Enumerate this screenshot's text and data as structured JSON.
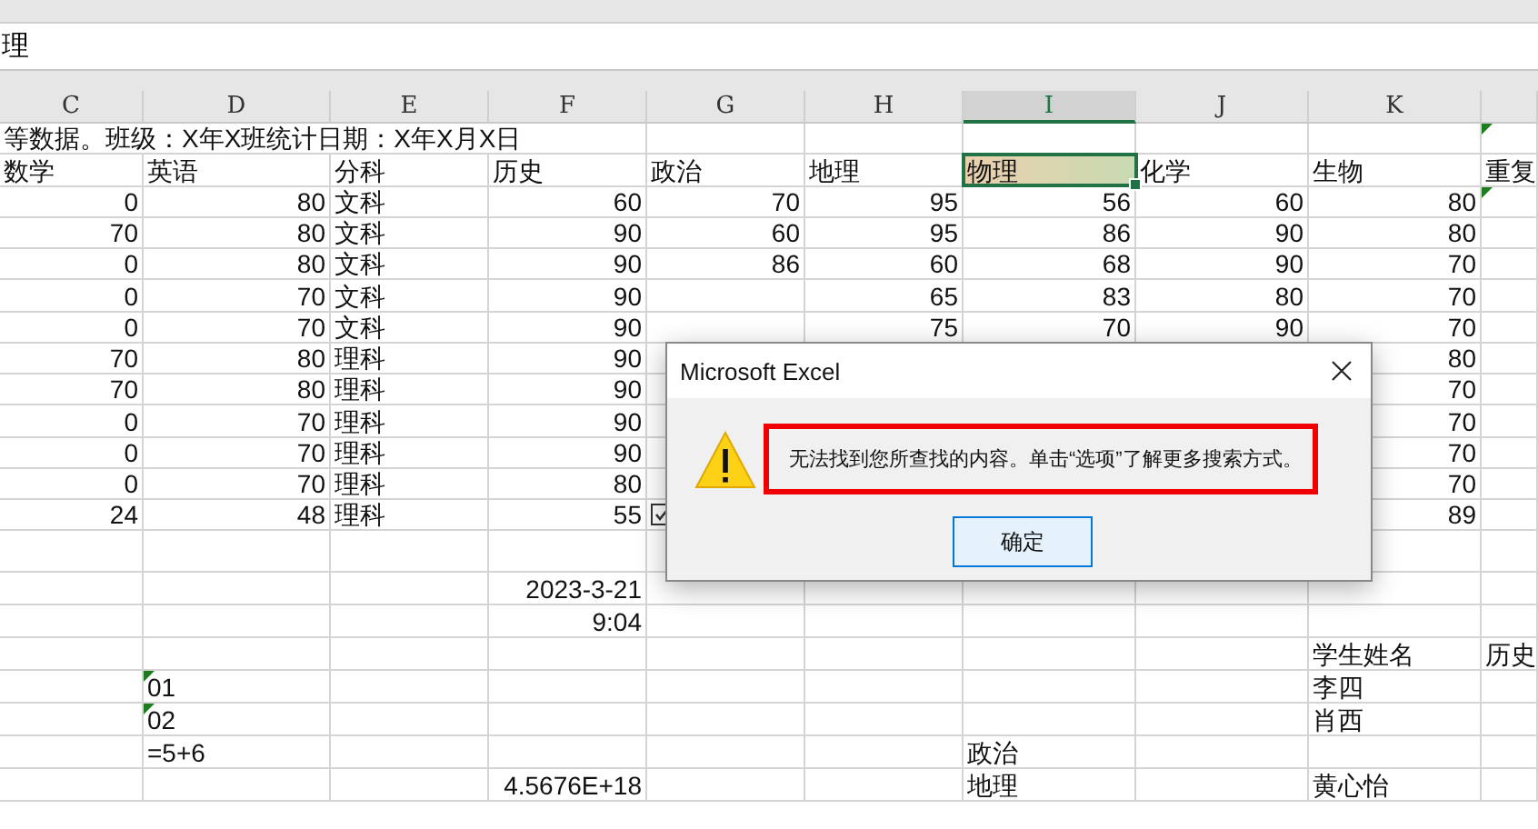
{
  "formula_bar": {
    "value": "理"
  },
  "columns": [
    {
      "label": "C",
      "selected": false
    },
    {
      "label": "D",
      "selected": false
    },
    {
      "label": "E",
      "selected": false
    },
    {
      "label": "F",
      "selected": false
    },
    {
      "label": "G",
      "selected": false
    },
    {
      "label": "H",
      "selected": false
    },
    {
      "label": "I",
      "selected": true
    },
    {
      "label": "J",
      "selected": false
    },
    {
      "label": "K",
      "selected": false
    },
    {
      "selected": false
    }
  ],
  "rows": [
    {
      "cells": [
        {
          "text": "等数据。班级：X年X班统计日期：X年X月X日",
          "kind": "overflow_text"
        },
        null,
        null,
        null,
        null,
        null,
        null,
        null,
        null,
        {
          "kind": "flag_only",
          "error_flag": true
        }
      ]
    },
    {
      "cells": [
        {
          "text": "数学",
          "kind": "text",
          "selected": false
        },
        {
          "text": "英语",
          "kind": "text",
          "selected": false
        },
        {
          "text": "分科",
          "kind": "text",
          "selected": false
        },
        {
          "text": "历史",
          "kind": "text",
          "selected": false
        },
        {
          "text": "政治",
          "kind": "text",
          "selected": false
        },
        {
          "text": "地理",
          "kind": "text",
          "selected": false
        },
        {
          "text": "物理",
          "kind": "text",
          "selected": true
        },
        {
          "text": "化学",
          "kind": "text",
          "selected": false
        },
        {
          "text": "生物",
          "kind": "text",
          "selected": false
        },
        {
          "text": "重复",
          "kind": "text",
          "selected": false
        }
      ]
    },
    {
      "cells": [
        {
          "text": "0",
          "kind": "number"
        },
        {
          "text": "80",
          "kind": "number"
        },
        {
          "text": "文科",
          "kind": "text"
        },
        {
          "text": "60",
          "kind": "number"
        },
        {
          "text": "70",
          "kind": "number"
        },
        {
          "text": "95",
          "kind": "number"
        },
        {
          "text": "56",
          "kind": "number"
        },
        {
          "text": "60",
          "kind": "number"
        },
        {
          "text": "80",
          "kind": "number"
        },
        {
          "kind": "flag_only",
          "error_flag": true
        }
      ]
    },
    {
      "cells": [
        {
          "text": "70",
          "kind": "number"
        },
        {
          "text": "80",
          "kind": "number"
        },
        {
          "text": "文科",
          "kind": "text"
        },
        {
          "text": "90",
          "kind": "number"
        },
        {
          "text": "60",
          "kind": "number"
        },
        {
          "text": "95",
          "kind": "number"
        },
        {
          "text": "86",
          "kind": "number"
        },
        {
          "text": "90",
          "kind": "number"
        },
        {
          "text": "80",
          "kind": "number"
        },
        null
      ]
    },
    {
      "cells": [
        {
          "text": "0",
          "kind": "number"
        },
        {
          "text": "80",
          "kind": "number"
        },
        {
          "text": "文科",
          "kind": "text"
        },
        {
          "text": "90",
          "kind": "number"
        },
        {
          "text": "86",
          "kind": "number"
        },
        {
          "text": "60",
          "kind": "number"
        },
        {
          "text": "68",
          "kind": "number"
        },
        {
          "text": "90",
          "kind": "number"
        },
        {
          "text": "70",
          "kind": "number"
        },
        null
      ]
    },
    {
      "cells": [
        {
          "text": "0",
          "kind": "number"
        },
        {
          "text": "70",
          "kind": "number"
        },
        {
          "text": "文科",
          "kind": "text"
        },
        {
          "text": "90",
          "kind": "number"
        },
        null,
        {
          "text": "65",
          "kind": "number"
        },
        {
          "text": "83",
          "kind": "number"
        },
        {
          "text": "80",
          "kind": "number"
        },
        {
          "text": "70",
          "kind": "number"
        },
        null
      ]
    },
    {
      "cells": [
        {
          "text": "0",
          "kind": "number"
        },
        {
          "text": "70",
          "kind": "number"
        },
        {
          "text": "文科",
          "kind": "text"
        },
        {
          "text": "90",
          "kind": "number"
        },
        null,
        {
          "text": "75",
          "kind": "number"
        },
        {
          "text": "70",
          "kind": "number"
        },
        {
          "text": "90",
          "kind": "number"
        },
        {
          "text": "70",
          "kind": "number"
        },
        null
      ]
    },
    {
      "cells": [
        {
          "text": "70",
          "kind": "number"
        },
        {
          "text": "80",
          "kind": "number"
        },
        {
          "text": "理科",
          "kind": "text"
        },
        {
          "text": "90",
          "kind": "number"
        },
        null,
        null,
        null,
        null,
        {
          "text": "80",
          "kind": "number"
        },
        null
      ]
    },
    {
      "cells": [
        {
          "text": "70",
          "kind": "number"
        },
        {
          "text": "80",
          "kind": "number"
        },
        {
          "text": "理科",
          "kind": "text"
        },
        {
          "text": "90",
          "kind": "number"
        },
        null,
        null,
        null,
        null,
        {
          "text": "70",
          "kind": "number"
        },
        null
      ]
    },
    {
      "cells": [
        {
          "text": "0",
          "kind": "number"
        },
        {
          "text": "70",
          "kind": "number"
        },
        {
          "text": "理科",
          "kind": "text"
        },
        {
          "text": "90",
          "kind": "number"
        },
        null,
        null,
        null,
        null,
        {
          "text": "70",
          "kind": "number"
        },
        null
      ]
    },
    {
      "cells": [
        {
          "text": "0",
          "kind": "number"
        },
        {
          "text": "70",
          "kind": "number"
        },
        {
          "text": "理科",
          "kind": "text"
        },
        {
          "text": "90",
          "kind": "number"
        },
        null,
        null,
        null,
        null,
        {
          "text": "70",
          "kind": "number"
        },
        null
      ]
    },
    {
      "cells": [
        {
          "text": "0",
          "kind": "number"
        },
        {
          "text": "70",
          "kind": "number"
        },
        {
          "text": "理科",
          "kind": "text"
        },
        {
          "text": "80",
          "kind": "number"
        },
        null,
        null,
        null,
        null,
        {
          "text": "70",
          "kind": "number"
        },
        null
      ]
    },
    {
      "cells": [
        {
          "text": "24",
          "kind": "number"
        },
        {
          "text": "48",
          "kind": "number"
        },
        {
          "text": "理科",
          "kind": "text"
        },
        {
          "text": "55",
          "kind": "number"
        },
        {
          "kind": "checkbox",
          "checked": true
        },
        null,
        null,
        null,
        {
          "text": "89",
          "kind": "number"
        },
        null
      ]
    },
    {
      "cells": [
        null,
        null,
        null,
        null,
        null,
        null,
        null,
        null,
        null,
        null
      ]
    },
    {
      "cells": [
        null,
        null,
        null,
        {
          "text": "2023-3-21",
          "kind": "number"
        },
        null,
        null,
        null,
        null,
        null,
        null
      ]
    },
    {
      "cells": [
        null,
        null,
        null,
        {
          "text": "9:04",
          "kind": "number"
        },
        null,
        null,
        null,
        null,
        null,
        null
      ]
    },
    {
      "cells": [
        null,
        null,
        null,
        null,
        null,
        null,
        null,
        null,
        {
          "text": "学生姓名",
          "kind": "text"
        },
        {
          "text": "历史",
          "kind": "text"
        }
      ]
    },
    {
      "cells": [
        null,
        {
          "text": "01",
          "kind": "text",
          "error_flag": true
        },
        null,
        null,
        null,
        null,
        null,
        null,
        {
          "text": "李四",
          "kind": "text"
        },
        null
      ]
    },
    {
      "cells": [
        null,
        {
          "text": "02",
          "kind": "text",
          "error_flag": true
        },
        null,
        null,
        null,
        null,
        null,
        null,
        {
          "text": "肖西",
          "kind": "text"
        },
        null
      ]
    },
    {
      "cells": [
        null,
        {
          "text": "=5+6",
          "kind": "text"
        },
        null,
        null,
        null,
        null,
        {
          "text": "政治",
          "kind": "text"
        },
        null,
        null,
        null
      ]
    },
    {
      "cells": [
        null,
        null,
        null,
        {
          "text": "4.5676E+18",
          "kind": "number"
        },
        null,
        null,
        {
          "text": "地理",
          "kind": "text"
        },
        null,
        {
          "text": "黄心怡",
          "kind": "text"
        },
        null
      ]
    }
  ],
  "dialog": {
    "title": "Microsoft Excel",
    "message": "无法找到您所查找的内容。单击“选项”了解更多搜索方式。",
    "highlighted": true,
    "button": "确定"
  }
}
